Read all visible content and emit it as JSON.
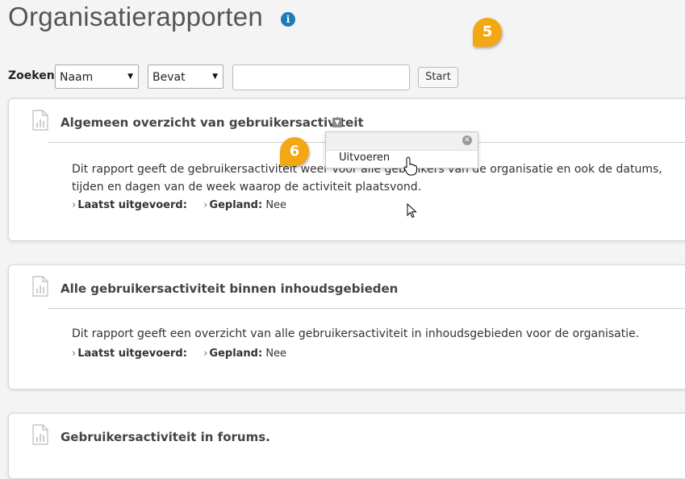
{
  "page": {
    "title": "Organisatierapporten",
    "info_icon": "info-icon",
    "accent_color": "#1f7bb7",
    "callout_color": "#f3a712"
  },
  "callouts": {
    "step5": "5",
    "step6": "6"
  },
  "search": {
    "label": "Zoeken",
    "field_select": "Naam",
    "operator_select": "Bevat",
    "query_value": "",
    "query_placeholder": "",
    "start_label": "Start"
  },
  "reports": [
    {
      "title": "Algemeen overzicht van gebruikersactiviteit",
      "description": "Dit rapport geeft de gebruikersactiviteit weer voor alle gebruikers van de organisatie en ook de datums, tijden en dagen van de week waarop de activiteit plaatsvond.",
      "last_run_label": "Laatst uitgevoerd:",
      "last_run_value": "",
      "scheduled_label": "Gepland:",
      "scheduled_value": "Nee"
    },
    {
      "title": "Alle gebruikersactiviteit binnen inhoudsgebieden",
      "description": "Dit rapport geeft een overzicht van alle gebruikersactiviteit in inhoudsgebieden voor de organisatie.",
      "last_run_label": "Laatst uitgevoerd:",
      "last_run_value": "",
      "scheduled_label": "Gepland:",
      "scheduled_value": "Nee"
    },
    {
      "title": "Gebruikersactiviteit in forums."
    }
  ],
  "context_menu": {
    "items": [
      {
        "label": "Uitvoeren"
      }
    ]
  }
}
